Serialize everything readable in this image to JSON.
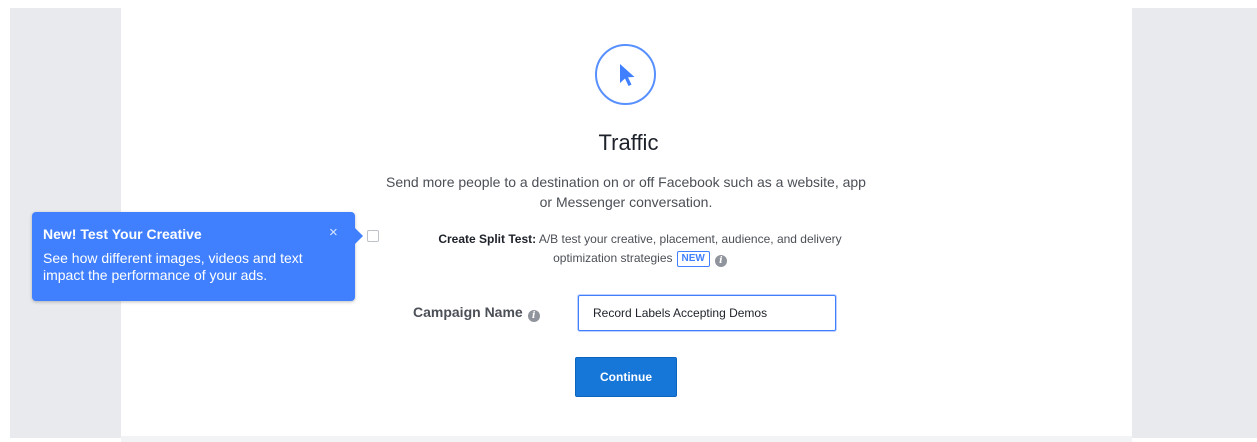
{
  "objective": {
    "icon": "cursor-arrow-icon",
    "title": "Traffic",
    "description_line1": "Send more people to a destination on or off Facebook such as a website, app",
    "description_line2": "or Messenger conversation."
  },
  "tooltip": {
    "title": "New! Test Your Creative",
    "body": "See how different images, videos and text impact the performance of your ads.",
    "close_label": "×"
  },
  "split_test": {
    "checked": false,
    "label": "Create Split Test:",
    "text_line1": " A/B test your creative, placement, audience, and delivery",
    "text_line2": "optimization strategies",
    "badge": "NEW",
    "info_icon": "i"
  },
  "campaign": {
    "label": "Campaign Name",
    "info_icon": "i",
    "value": "Record Labels Accepting Demos"
  },
  "actions": {
    "continue_label": "Continue"
  },
  "colors": {
    "accent": "#4080ff",
    "button": "#1677d9",
    "gutter": "#e9eaed"
  }
}
